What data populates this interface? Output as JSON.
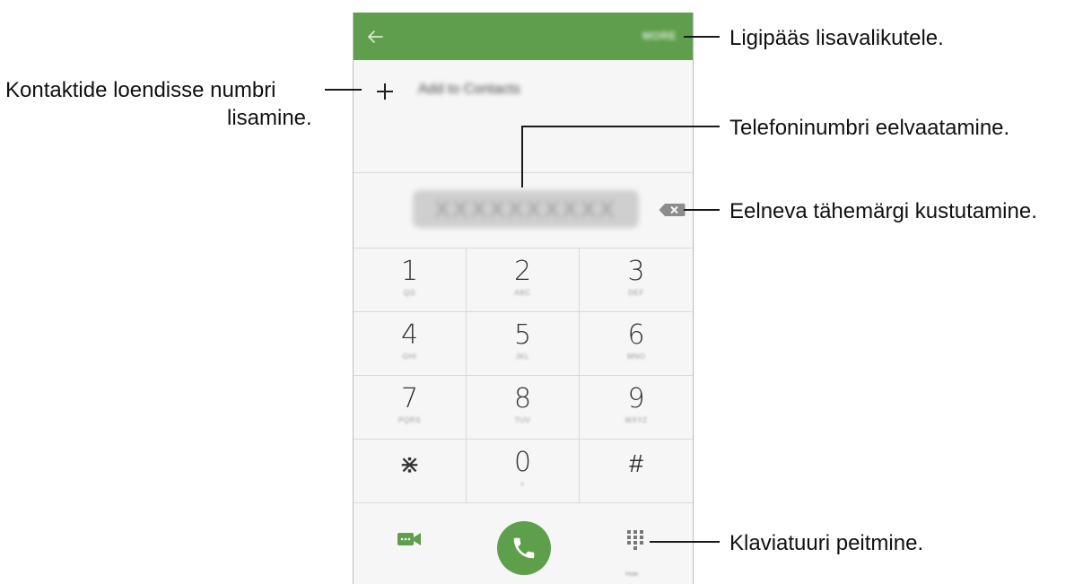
{
  "dialer": {
    "more_label": "MORE",
    "add_contact_icon": "plus-icon",
    "add_contact_label": "Add to Contacts",
    "number_preview": "XXXXXXXXXX",
    "keys": [
      {
        "digit": "1",
        "letters": "QΩ"
      },
      {
        "digit": "2",
        "letters": "ABC"
      },
      {
        "digit": "3",
        "letters": "DEF"
      },
      {
        "digit": "4",
        "letters": "GHI"
      },
      {
        "digit": "5",
        "letters": "JKL"
      },
      {
        "digit": "6",
        "letters": "MNO"
      },
      {
        "digit": "7",
        "letters": "PQRS"
      },
      {
        "digit": "8",
        "letters": "TUV"
      },
      {
        "digit": "9",
        "letters": "WXYZ"
      },
      {
        "digit": "⋇",
        "letters": ""
      },
      {
        "digit": "0",
        "letters": "+"
      },
      {
        "digit": "#",
        "letters": ""
      }
    ],
    "hide_keypad_label": "Hide",
    "colors": {
      "accent": "#5f9e4c",
      "call_button": "#5e9f4b"
    }
  },
  "annotations": {
    "more_options": "Ligipääs lisavalikutele.",
    "add_to_contacts_line1": "Kontaktide loendisse numbri",
    "add_to_contacts_line2": "lisamine.",
    "preview_number": "Telefoninumbri eelvaatamine.",
    "delete_character": "Eelneva tähemärgi kustutamine.",
    "hide_keypad": "Klaviatuuri peitmine."
  }
}
